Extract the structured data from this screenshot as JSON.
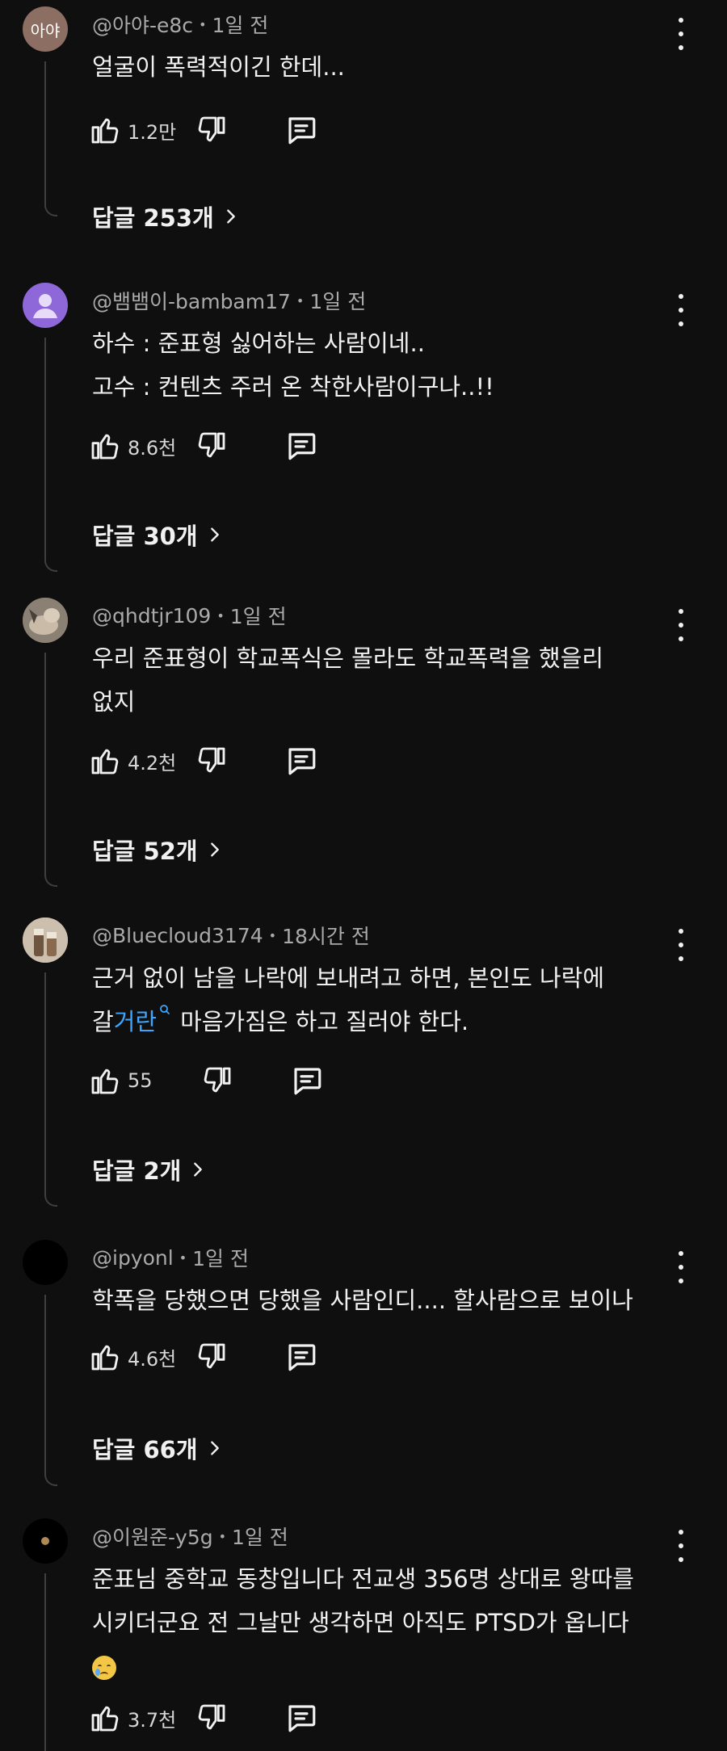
{
  "comments": [
    {
      "avatar_text": "아야",
      "avatar_color": "#8d6e63",
      "author": "@아야-e8c",
      "time": "1일 전",
      "lines": [
        "얼굴이 폭력적이긴 한데..."
      ],
      "likes": "1.2만",
      "replies": "답글 253개"
    },
    {
      "avatar_color": "#8e68d8",
      "author": "@뱀뱀이-bambam17",
      "time": "1일 전",
      "lines": [
        "하수 : 준표형 싫어하는 사람이네..",
        "고수 : 컨텐츠 주러 온 착한사람이구나..!!"
      ],
      "likes": "8.6천",
      "replies": "답글 30개"
    },
    {
      "avatar_color": "#6b6258",
      "author": "@qhdtjr109",
      "time": "1일 전",
      "lines": [
        "우리 준표형이 학교폭식은 몰라도 학교폭력을 했을리",
        "없지"
      ],
      "likes": "4.2천",
      "replies": "답글 52개"
    },
    {
      "avatar_color": "#b9a48e",
      "author": "@Bluecloud3174",
      "time": "18시간 전",
      "line1": "근거 없이 남을 나락에 보내려고 하면, 본인도 나락에",
      "line2_pre": "갈",
      "line2_link": "거란",
      "line2_post": "마음가짐은 하고 질러야 한다.",
      "likes": "55",
      "replies": "답글 2개"
    },
    {
      "avatar_color": "#000000",
      "author": "@ipyonl",
      "time": "1일 전",
      "lines": [
        "학폭을 당했으면 당했을 사람인디.... 할사람으로 보이나"
      ],
      "likes": "4.6천",
      "replies": "답글 66개"
    },
    {
      "avatar_color": "#000000",
      "author": "@이원준-y5g",
      "time": "1일 전",
      "lines": [
        "준표님 중학교 동창입니다 전교생 356명 상대로 왕따를",
        "시키더군요 전 그날만 생각하면 아직도 PTSD가 옵니다"
      ],
      "likes": "3.7천"
    }
  ]
}
